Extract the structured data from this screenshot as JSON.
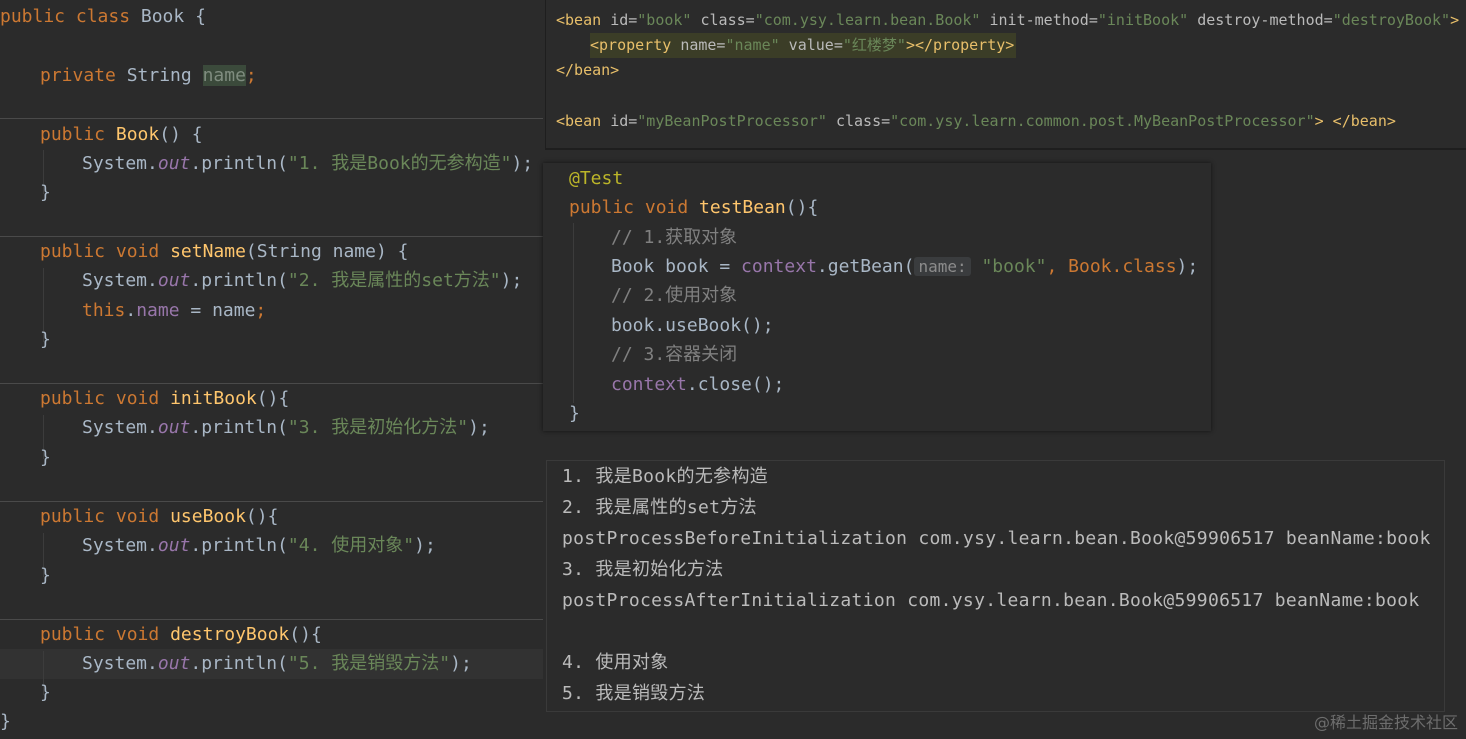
{
  "colors": {
    "background": "#2b2b2b",
    "keyword": "#cc7832",
    "plain_text": "#a9b7c6",
    "method_name": "#ffc66d",
    "string": "#6a8759",
    "field": "#9876aa",
    "comment": "#808080",
    "annotation": "#bbb529",
    "xml_tag": "#e8bf6a"
  },
  "book_class": {
    "l1": {
      "kw": "public class",
      "name": " Book {"
    },
    "l2": {
      "kw": "private",
      "type": " String ",
      "field": "name",
      "semi": ";"
    },
    "l3": {
      "kw": "public",
      "name": "Book",
      "rest": "() {"
    },
    "l4": {
      "a": "System.",
      "out": "out",
      "b": ".println(",
      "str": "\"1. 我是Book的无参构造\"",
      "c": ");"
    },
    "l5": "}",
    "l6": {
      "kw": "public void",
      "name": "setName",
      "rest": "(String name) {"
    },
    "l7": {
      "a": "System.",
      "out": "out",
      "b": ".println(",
      "str": "\"2. 我是属性的set方法\"",
      "c": ");"
    },
    "l8": {
      "kw": "this",
      "dot": ".",
      "field": "name",
      "rest": " = name",
      "semi": ";"
    },
    "l9": "}",
    "l10": {
      "kw": "public void",
      "name": "initBook",
      "rest": "(){"
    },
    "l11": {
      "a": "System.",
      "out": "out",
      "b": ".println(",
      "str": "\"3. 我是初始化方法\"",
      "c": ");"
    },
    "l12": "}",
    "l13": {
      "kw": "public void",
      "name": "useBook",
      "rest": "(){"
    },
    "l14": {
      "a": "System.",
      "out": "out",
      "b": ".println(",
      "str": "\"4. 使用对象\"",
      "c": ");"
    },
    "l15": "}",
    "l16": {
      "kw": "public void",
      "name": "destroyBook",
      "rest": "(){"
    },
    "l17": {
      "a": "System.",
      "out": "out",
      "b": ".println(",
      "str": "\"5. 我是销毁方法\"",
      "c": ");"
    },
    "l18": "}",
    "l19": "}"
  },
  "xml": {
    "bean1_open": {
      "t1": "<bean ",
      "a1": "id=",
      "v1": "\"book\"",
      "a2": " class=",
      "v2": "\"com.ysy.learn.bean.Book\"",
      "a3": " init-method=",
      "v3": "\"initBook\"",
      "a4": " destroy-method=",
      "v4": "\"destroyBook\"",
      "t2": ">"
    },
    "property": {
      "t1": "<property ",
      "a1": "name=",
      "v1": "\"name\"",
      "a2": " value=",
      "v2": "\"红楼梦\"",
      "t2": "></property>"
    },
    "bean1_close": "</bean>",
    "bean2": {
      "t1": "<bean ",
      "a1": "id=",
      "v1": "\"myBeanPostProcessor\"",
      "a2": " class=",
      "v2": "\"com.ysy.learn.common.post.MyBeanPostProcessor\"",
      "t2": "> </bean>"
    }
  },
  "test_method": {
    "annotation": "@Test",
    "sig": {
      "kw": "public void",
      "name": " testBean",
      "rest": "(){"
    },
    "c1": "// 1.获取对象",
    "get": {
      "a": "Book book = ",
      "ctx": "context",
      "b": ".getBean(",
      "hint": "name:",
      "str": " \"book\"",
      "c": ", Book.",
      "cls": "class",
      "d": ");"
    },
    "c2": "// 2.使用对象",
    "use": "book.useBook();",
    "c3": "// 3.容器关闭",
    "close": {
      "ctx": "context",
      "b": ".close();"
    },
    "end": "}"
  },
  "console_output": [
    "1. 我是Book的无参构造",
    "2. 我是属性的set方法",
    "postProcessBeforeInitialization com.ysy.learn.bean.Book@59906517 beanName:book",
    "3. 我是初始化方法",
    "postProcessAfterInitialization com.ysy.learn.bean.Book@59906517 beanName:book",
    "",
    "4. 使用对象",
    "5. 我是销毁方法"
  ],
  "watermark": "@稀土掘金技术社区"
}
